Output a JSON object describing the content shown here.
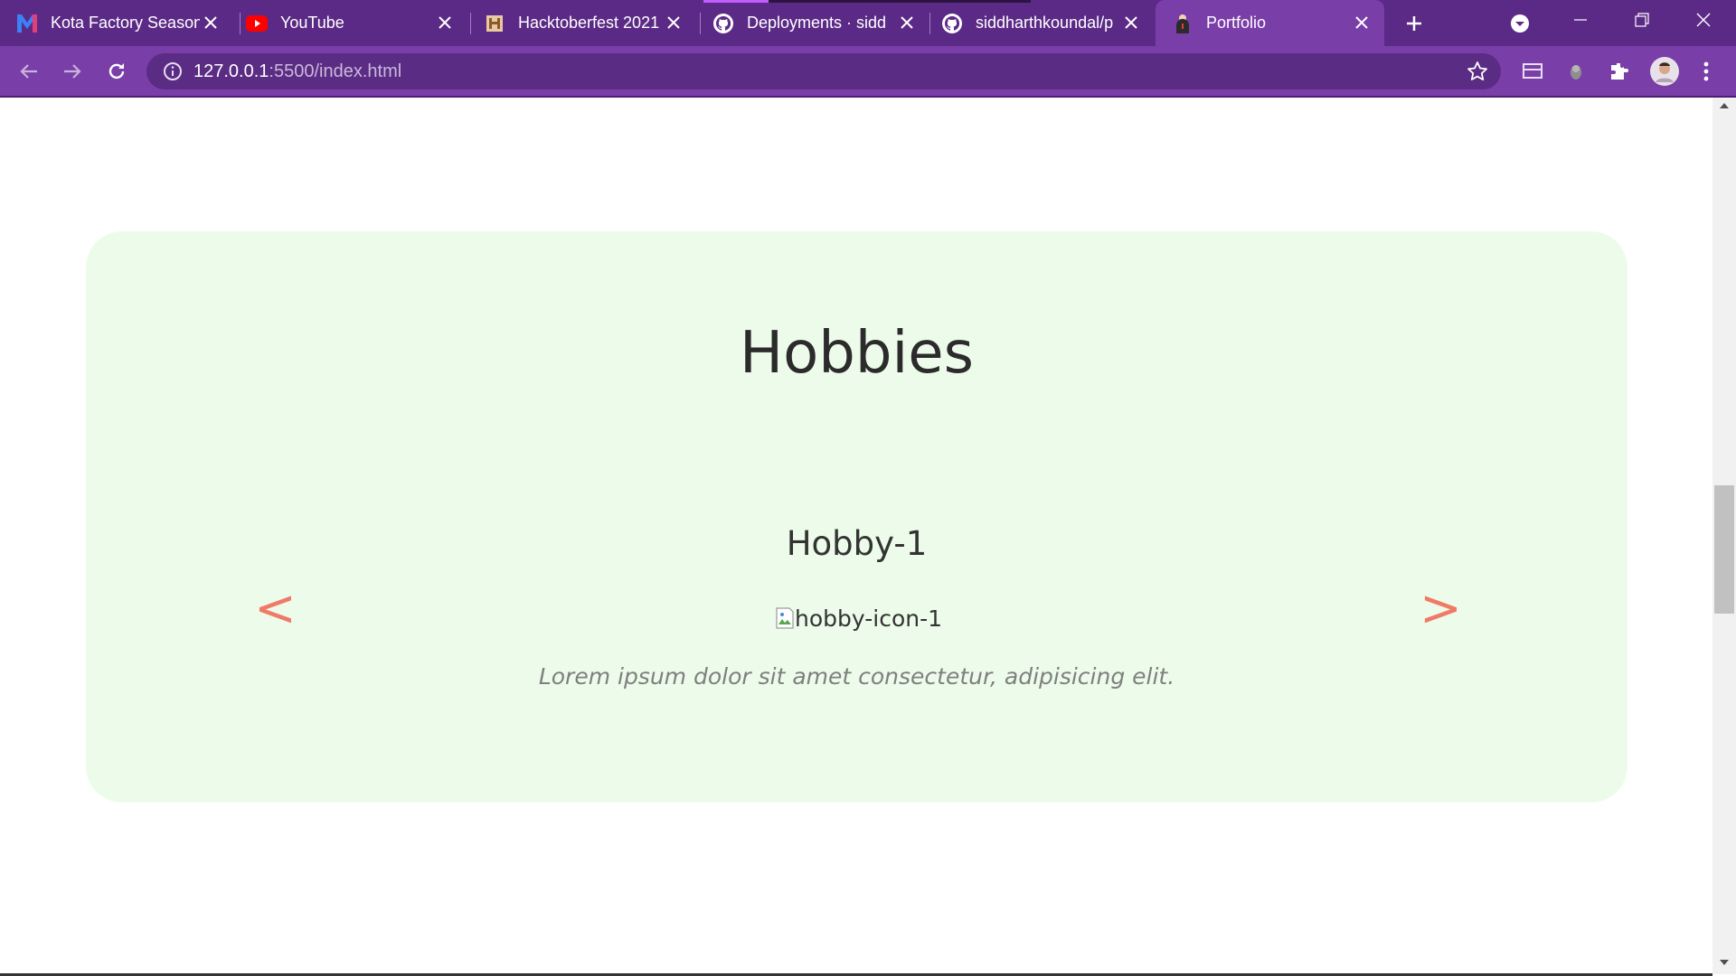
{
  "browser": {
    "tabs": [
      {
        "title": "Kota Factory Season",
        "icon": "m-logo-icon"
      },
      {
        "title": "YouTube",
        "icon": "youtube-icon"
      },
      {
        "title": "Hacktoberfest 2021",
        "icon": "hacktoberfest-icon"
      },
      {
        "title": "Deployments · siddh",
        "icon": "github-icon"
      },
      {
        "title": "siddharthkoundal/p",
        "icon": "github-icon"
      },
      {
        "title": "Portfolio",
        "icon": "portfolio-icon",
        "active": true
      }
    ],
    "url_host": "127.0.0.1",
    "url_rest": ":5500/index.html",
    "colors": {
      "tabstrip": "#5b2a86",
      "toolbar": "#7a3ea9",
      "omnibox": "#5a2c83"
    }
  },
  "page": {
    "section_title": "Hobbies",
    "hobby_name": "Hobby-1",
    "hobby_image_alt": "hobby-icon-1",
    "hobby_description": "Lorem ipsum dolor sit amet consectetur, adipisicing elit.",
    "prev_label": "<",
    "next_label": ">",
    "colors": {
      "card": "#edfcea",
      "arrows": "#ef7b67"
    }
  }
}
